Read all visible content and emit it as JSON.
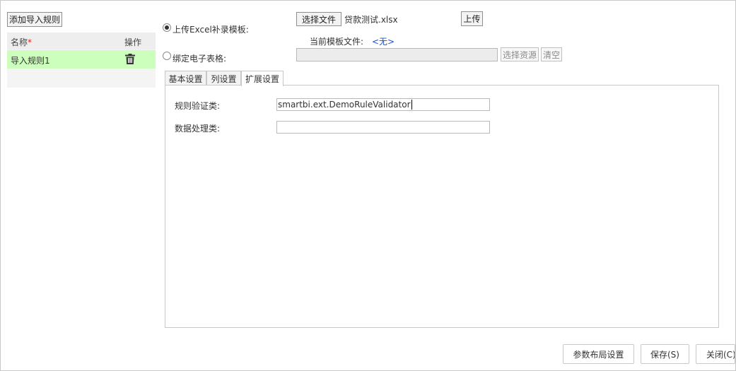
{
  "toolbar": {
    "add_rule_label": "添加导入规则"
  },
  "rules_table": {
    "columns": {
      "name": "名称",
      "required_mark": "*",
      "action": "操作"
    },
    "rows": [
      {
        "name": "导入规则1",
        "action_icon": "trash-icon"
      }
    ]
  },
  "source": {
    "excel_option_label": "上传Excel补录模板:",
    "excel_option_selected": true,
    "choose_file_label": "选择文件",
    "chosen_file_name": "贷款测试.xlsx",
    "upload_label": "上传",
    "current_template_label": "当前模板文件:",
    "current_template_value": "<无>",
    "bind_sheet_option_label": "绑定电子表格:",
    "bind_sheet_value": "",
    "select_resource_label": "选择资源",
    "clear_label": "清空"
  },
  "tabs": [
    {
      "label": "基本设置",
      "active": false
    },
    {
      "label": "列设置",
      "active": false
    },
    {
      "label": "扩展设置",
      "active": true
    }
  ],
  "extension": {
    "validator_label": "规则验证类:",
    "validator_value": "smartbi.ext.DemoRuleValidator",
    "processor_label": "数据处理类:",
    "processor_value": ""
  },
  "footer": {
    "layout_settings_label": "参数布局设置",
    "save_label": "保存(S)",
    "close_label": "关闭(C)"
  },
  "colors": {
    "selected_row": "#ccffbb",
    "link": "#1a4fc4",
    "required": "#e02020"
  }
}
